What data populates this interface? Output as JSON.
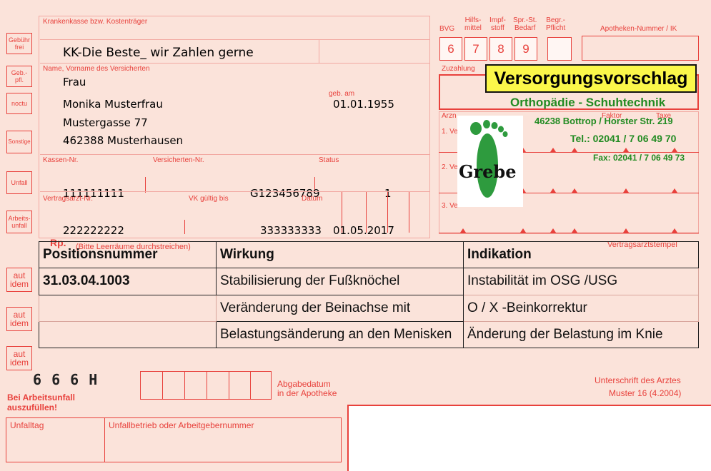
{
  "form": {
    "label_insurer": "Krankenkasse bzw. Kostenträger",
    "label_name": "Name, Vorname des Versicherten",
    "label_dob": "geb. am",
    "label_kassen_nr": "Kassen-Nr.",
    "label_versicherten_nr": "Versicherten-Nr.",
    "label_status": "Status",
    "label_arzt_nr": "Vertragsarzt-Nr.",
    "label_vk": "VK gültig bis",
    "label_datum": "Datum",
    "label_rp": "Rp.",
    "label_rp_hint": "(Bitte Leerräume durchstreichen)",
    "label_vertragsarztstempel": "Vertragsarztstempel",
    "label_zuzahlung": "Zuzahlung",
    "label_bvg": "BVG",
    "label_hilfsmittel": "Hilfs-\nmittel",
    "label_impfstoff": "Impf-\nstoff",
    "label_sprst": "Spr.-St.\nBedarf",
    "label_begr": "Begr.-\nPflicht",
    "label_apotheken": "Apotheken-Nummer / IK",
    "num_6": "6",
    "num_7": "7",
    "num_8": "8",
    "num_9": "9",
    "label_arzn": "Arzn",
    "label_faktor": "Faktor",
    "label_taxe": "Taxe",
    "label_1ve": "1. Ve",
    "label_2ve": "2. Ve",
    "label_3ve": "3. Ve",
    "side_gebuehr": "Gebühr\nfrei",
    "side_gebpfl": "Geb.-\npfl.",
    "side_noctu": "noctu",
    "side_sonstige": "Sonstige",
    "side_unfall": "Unfall",
    "side_arbeitsunfall": "Arbeits-\nunfall",
    "side_aut_idem": "aut\nidem",
    "barcode_text": "6 6 6 H",
    "bei_arbeitsunfall": "Bei Arbeitsunfall\nauszufüllen!",
    "abgabedatum": "Abgabedatum\nin der Apotheke",
    "unterschrift": "Unterschrift des Arztes",
    "muster": "Muster 16 (4.2004)",
    "unfalltag": "Unfalltag",
    "unfallbetrieb": "Unfallbetrieb oder Arbeitgebernummer"
  },
  "patient": {
    "insurer": "KK-Die Beste_ wir Zahlen gerne",
    "salutation": "Frau",
    "name": "Monika Musterfrau",
    "street": "Mustergasse 77",
    "city": "462388 Musterhausen",
    "dob": "01.01.1955",
    "kassen_nr": "111111111",
    "versicherten_nr": "G123456789",
    "status": "1",
    "arzt_nr": "222222222",
    "vk": "333333333",
    "datum": "01.05.2017"
  },
  "stamp": {
    "title": "Versorgungsvorschlag",
    "subtitle": "Orthopädie - Schuhtechnik",
    "address": "46238 Bottrop / Horster Str. 219",
    "tel": "Tel.: 02041 / 7 06 49 70",
    "fax": "Fax: 02041 / 7 06 49 73",
    "logo_text": "Grebe"
  },
  "table": {
    "headers": [
      "Positionsnummer",
      "Wirkung",
      "Indikation"
    ],
    "rows": [
      [
        "31.03.04.1003",
        "Stabilisierung der Fußknöchel",
        "Instabilität im OSG /USG"
      ],
      [
        "",
        "Veränderung der Beinachse mit",
        "O / X -Beinkorrektur"
      ],
      [
        "",
        "Belastungsänderung an den Menisken",
        "Änderung der Belastung im Knie"
      ]
    ]
  },
  "colors": {
    "form_red": "#e8413c",
    "form_bg": "#fbe3da",
    "stamp_yellow": "#fbf74a",
    "stamp_green": "#228b22"
  }
}
